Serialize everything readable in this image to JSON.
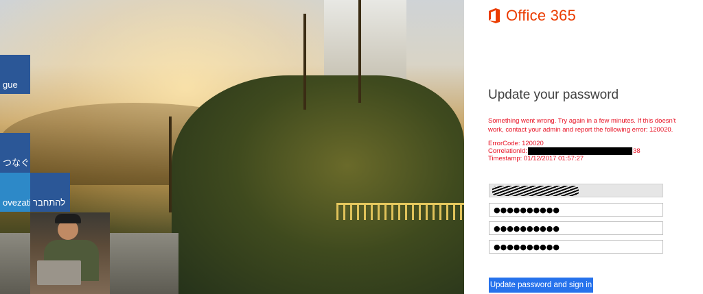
{
  "brand": {
    "name": "Office 365",
    "color": "#eb3c00"
  },
  "tiles": [
    {
      "label": "gue"
    },
    {
      "label": "つなぐ"
    },
    {
      "label": "ovezati"
    },
    {
      "label": "להתחבר"
    }
  ],
  "form": {
    "heading": "Update your password",
    "error_message": "Something went wrong. Try again in a few minutes. If this doesn't work, contact your admin and report the following error: 120020.",
    "error_code_label": "ErrorCode: 120020",
    "correlation_label": "CorrelationId:",
    "correlation_suffix": "38",
    "timestamp_label": "Timestamp: 01/12/2017 01:57:27",
    "password_old": "●●●●●●●●●●",
    "password_new": "●●●●●●●●●●",
    "password_confirm": "●●●●●●●●●●",
    "submit_label": "Update password and sign in",
    "accent_color": "#2672ec",
    "error_color": "#e81123"
  }
}
